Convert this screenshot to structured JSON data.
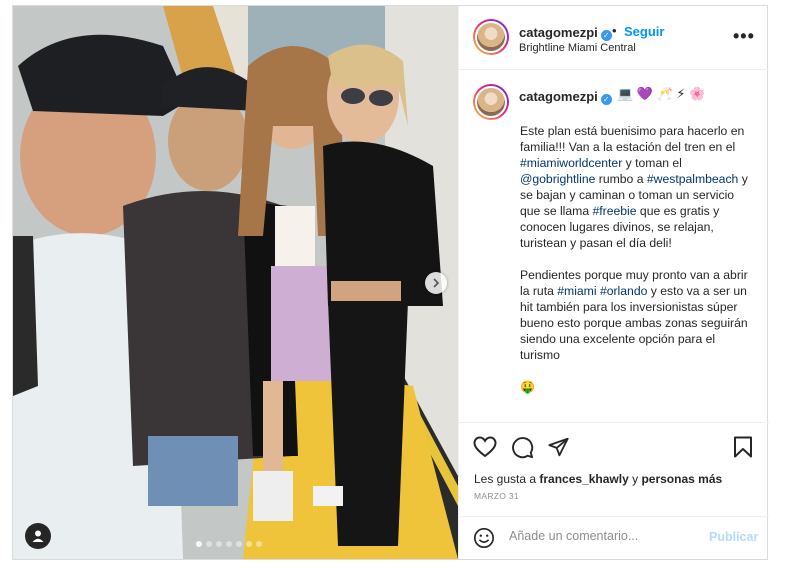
{
  "header": {
    "username": "catagomezpi",
    "separator": "•",
    "follow_label": "Seguir",
    "location": "Brightline Miami Central",
    "more_label": "•••"
  },
  "caption": {
    "username": "catagomezpi",
    "emojis": "💻 💜 🥂 ⚡ 🌸",
    "paragraph1": [
      {
        "t": "Este plan está buenisimo para hacerlo en familia!!! Van a la estación del tren en el ",
        "tag": false
      },
      {
        "t": "#miamiworldcenter",
        "tag": true
      },
      {
        "t": " y toman el ",
        "tag": false
      },
      {
        "t": "@gobrightline",
        "tag": true
      },
      {
        "t": " rumbo a ",
        "tag": false
      },
      {
        "t": "#westpalmbeach",
        "tag": true
      },
      {
        "t": " y se bajan y caminan o toman un servicio que se llama ",
        "tag": false
      },
      {
        "t": "#freebie",
        "tag": true
      },
      {
        "t": " que es gratis y conocen lugares divinos, se relajan, turistean y pasan el día deli!",
        "tag": false
      }
    ],
    "paragraph2": [
      {
        "t": "Pendientes porque muy pronto van a abrir la ruta ",
        "tag": false
      },
      {
        "t": "#miami",
        "tag": true
      },
      {
        "t": " ",
        "tag": false
      },
      {
        "t": "#orlando",
        "tag": true
      },
      {
        "t": " y esto va a ser un hit también para los inversionistas súper bueno esto porque ambas zonas seguirán siendo una excelente opción para el turismo",
        "tag": false
      }
    ],
    "end_emoji": "🤑"
  },
  "likes": {
    "prefix": "Les gusta a ",
    "user": "frances_khawly",
    "middle": " y ",
    "suffix": "personas más"
  },
  "date": "MARZO 31",
  "comment": {
    "placeholder": "Añade un comentario...",
    "post_label": "Publicar"
  },
  "carousel": {
    "total_slides": 7,
    "active_index": 0
  },
  "colors": {
    "link": "#0095f6",
    "hashtag": "#00376b",
    "post_disabled": "#b3dbff",
    "border": "#dbdbdb"
  }
}
